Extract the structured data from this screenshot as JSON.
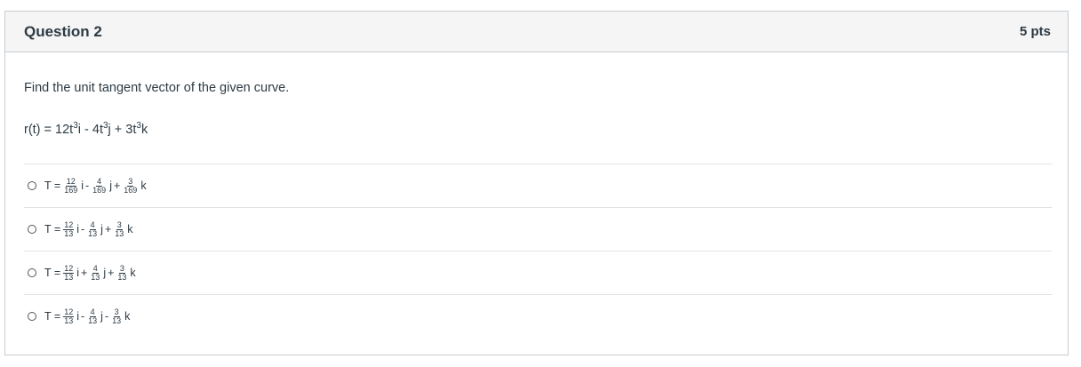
{
  "question": {
    "title": "Question 2",
    "points": "5 pts",
    "prompt": "Find the unit tangent vector of the given curve.",
    "equation": {
      "lhs": "r(t) = ",
      "parts": [
        "12t",
        "3",
        "i - 4t",
        "3",
        "j + 3t",
        "3",
        "k"
      ]
    }
  },
  "answers": [
    {
      "prefix": "T =",
      "terms": [
        {
          "num": "12",
          "den": "169",
          "unit": "i",
          "op": "-"
        },
        {
          "num": "4",
          "den": "169",
          "unit": "j",
          "op": "+"
        },
        {
          "num": "3",
          "den": "169",
          "unit": "k",
          "op": ""
        }
      ]
    },
    {
      "prefix": "T =",
      "terms": [
        {
          "num": "12",
          "den": "13",
          "unit": "i",
          "op": "-"
        },
        {
          "num": "4",
          "den": "13",
          "unit": "j",
          "op": "+"
        },
        {
          "num": "3",
          "den": "13",
          "unit": "k",
          "op": ""
        }
      ]
    },
    {
      "prefix": "T =",
      "terms": [
        {
          "num": "12",
          "den": "13",
          "unit": "i",
          "op": "+"
        },
        {
          "num": "4",
          "den": "13",
          "unit": "j",
          "op": "+"
        },
        {
          "num": "3",
          "den": "13",
          "unit": "k",
          "op": ""
        }
      ]
    },
    {
      "prefix": "T =",
      "terms": [
        {
          "num": "12",
          "den": "13",
          "unit": "i",
          "op": "-"
        },
        {
          "num": "4",
          "den": "13",
          "unit": "j",
          "op": "-"
        },
        {
          "num": "3",
          "den": "13",
          "unit": "k",
          "op": ""
        }
      ]
    }
  ]
}
